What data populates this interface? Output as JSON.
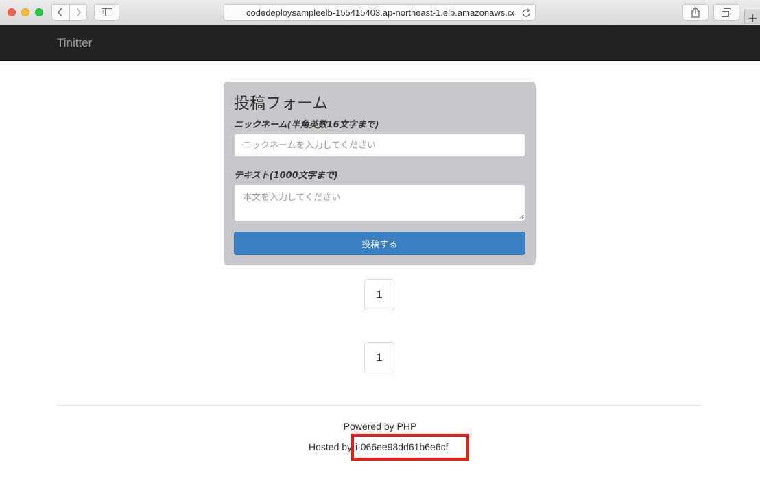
{
  "browser": {
    "url": "codedeploysampleelb-155415403.ap-northeast-1.elb.amazonaws.co"
  },
  "navbar": {
    "brand": "Tinitter"
  },
  "form": {
    "title": "投稿フォーム",
    "nickname_label": "ニックネーム(半角英数16文字まで)",
    "nickname_placeholder": "ニックネームを入力してください",
    "nickname_value": "",
    "text_label": "テキスト(1000文字まで)",
    "text_placeholder": "本文を入力してください",
    "text_value": "",
    "submit_label": "投稿する"
  },
  "pagination": {
    "top_page": "1",
    "bottom_page": "1"
  },
  "footer": {
    "powered": "Powered by PHP",
    "hosted_label": "Hosted by",
    "instance_id": "i-066ee98dd61b6e6cf"
  },
  "colors": {
    "navbar_bg": "#222222",
    "panel_bg": "#c8c8cc",
    "submit_bg": "#3a7fc4",
    "highlight_border": "#f2190f"
  }
}
